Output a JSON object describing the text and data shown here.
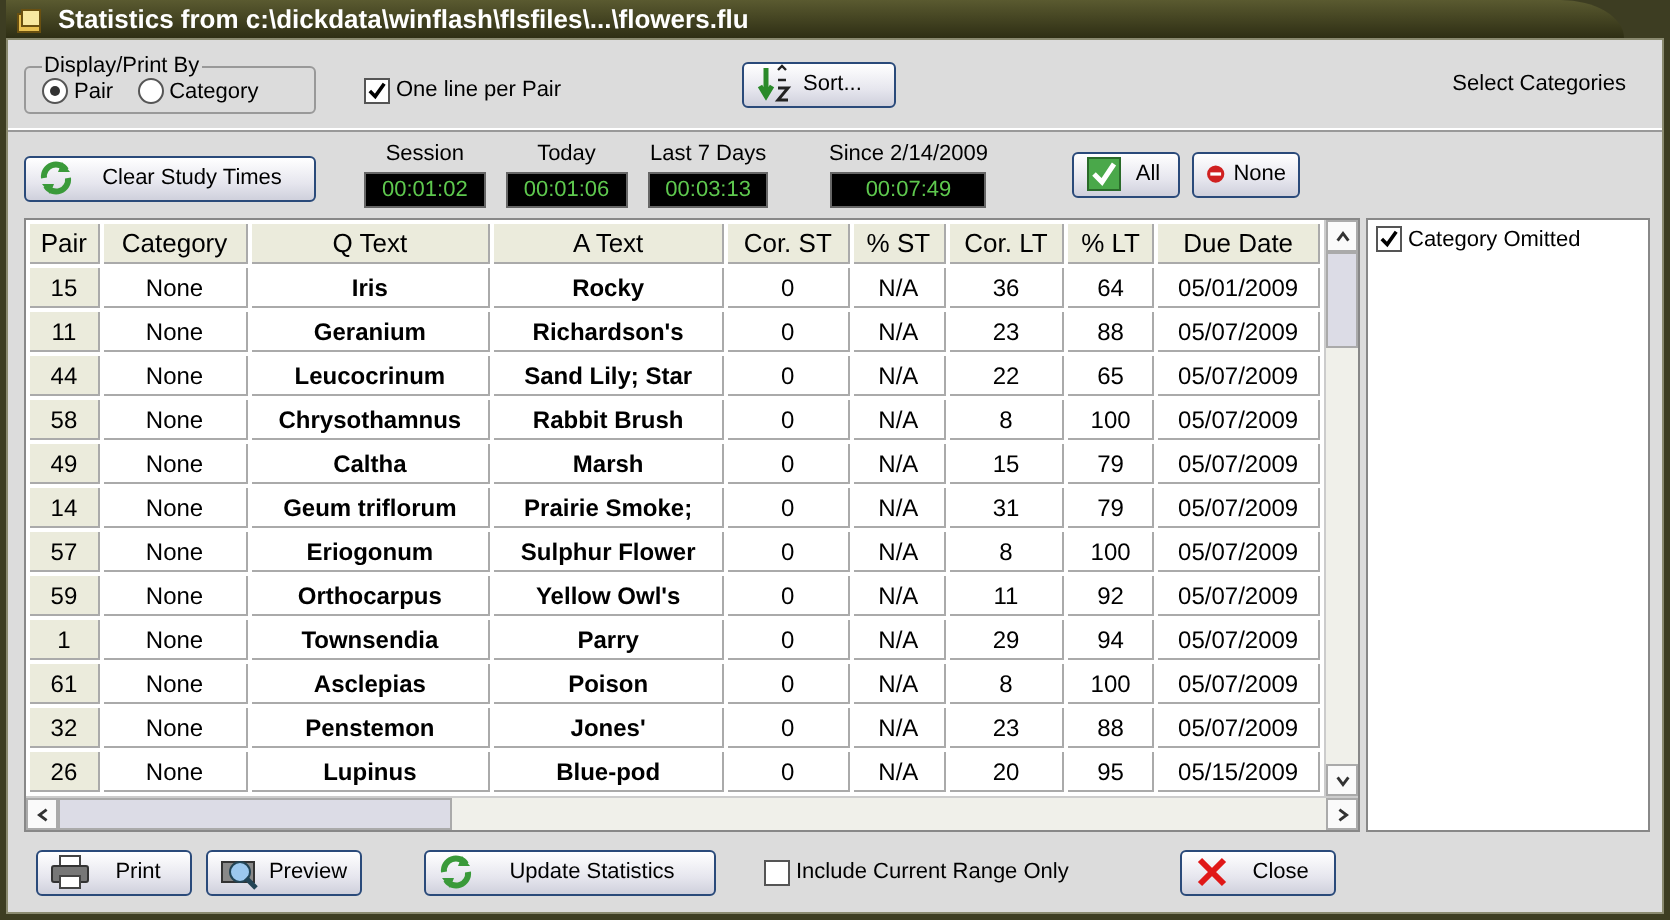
{
  "window": {
    "title": "Statistics from c:\\dickdata\\winflash\\flsfiles\\...\\flowers.flu"
  },
  "display_by": {
    "label": "Display/Print By",
    "options": [
      {
        "label": "Pair",
        "selected": true
      },
      {
        "label": "Category",
        "selected": false
      }
    ]
  },
  "one_line_per_pair": {
    "label": "One line per Pair",
    "checked": true
  },
  "sort_button": "Sort...",
  "select_categories_label": "Select Categories",
  "clear_button": "Clear Study Times",
  "timers": [
    {
      "label": "Session",
      "value": "00:01:02"
    },
    {
      "label": "Today",
      "value": "00:01:06"
    },
    {
      "label": "Last 7 Days",
      "value": "00:03:13"
    },
    {
      "label": "Since 2/14/2009",
      "value": "00:07:49"
    }
  ],
  "all_button": "All",
  "none_button": "None",
  "table": {
    "columns": [
      "Pair",
      "Category",
      "Q Text",
      "A Text",
      "Cor. ST",
      "% ST",
      "Cor. LT",
      "% LT",
      "Due Date"
    ],
    "rows": [
      [
        "15",
        "None",
        "Iris",
        "Rocky",
        "0",
        "N/A",
        "36",
        "64",
        "05/01/2009"
      ],
      [
        "11",
        "None",
        "Geranium",
        "Richardson's",
        "0",
        "N/A",
        "23",
        "88",
        "05/07/2009"
      ],
      [
        "44",
        "None",
        "Leucocrinum",
        "Sand Lily; Star",
        "0",
        "N/A",
        "22",
        "65",
        "05/07/2009"
      ],
      [
        "58",
        "None",
        "Chrysothamnus",
        "Rabbit Brush",
        "0",
        "N/A",
        "8",
        "100",
        "05/07/2009"
      ],
      [
        "49",
        "None",
        "Caltha",
        "Marsh",
        "0",
        "N/A",
        "15",
        "79",
        "05/07/2009"
      ],
      [
        "14",
        "None",
        "Geum triflorum",
        "Prairie Smoke;",
        "0",
        "N/A",
        "31",
        "79",
        "05/07/2009"
      ],
      [
        "57",
        "None",
        "Eriogonum",
        "Sulphur Flower",
        "0",
        "N/A",
        "8",
        "100",
        "05/07/2009"
      ],
      [
        "59",
        "None",
        "Orthocarpus",
        "Yellow Owl's",
        "0",
        "N/A",
        "11",
        "92",
        "05/07/2009"
      ],
      [
        "1",
        "None",
        "Townsendia",
        "Parry",
        "0",
        "N/A",
        "29",
        "94",
        "05/07/2009"
      ],
      [
        "61",
        "None",
        "Asclepias",
        "Poison",
        "0",
        "N/A",
        "8",
        "100",
        "05/07/2009"
      ],
      [
        "32",
        "None",
        "Penstemon",
        "Jones'",
        "0",
        "N/A",
        "23",
        "88",
        "05/07/2009"
      ],
      [
        "26",
        "None",
        "Lupinus",
        "Blue-pod",
        "0",
        "N/A",
        "20",
        "95",
        "05/15/2009"
      ]
    ]
  },
  "categories": [
    {
      "label": "Category Omitted",
      "checked": true
    }
  ],
  "print_button": "Print",
  "preview_button": "Preview",
  "update_button": "Update Statistics",
  "include_current_range": {
    "label": "Include Current Range Only",
    "checked": false
  },
  "close_button": "Close"
}
